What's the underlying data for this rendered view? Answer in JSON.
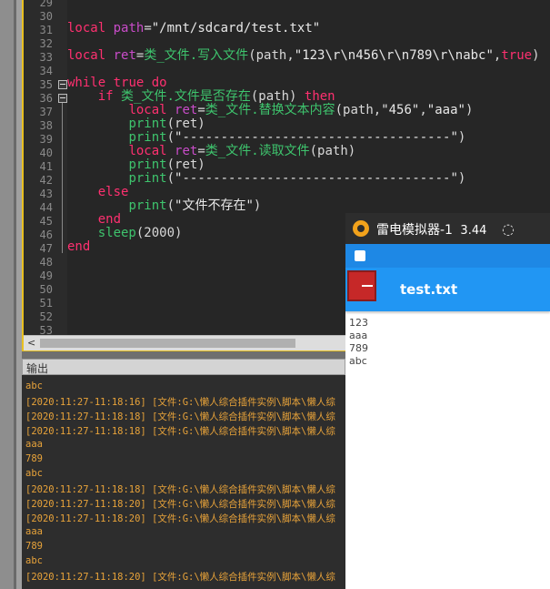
{
  "editor": {
    "line_numbers": [
      "29",
      "30",
      "31",
      "32",
      "33",
      "34",
      "35",
      "36",
      "37",
      "38",
      "39",
      "40",
      "41",
      "42",
      "43",
      "44",
      "45",
      "46",
      "47",
      "48",
      "49",
      "50",
      "51",
      "52",
      "53"
    ],
    "lines": [
      {
        "n": "31",
        "tokens": [
          [
            "kw",
            "local"
          ],
          [
            "plain",
            " "
          ],
          [
            "var",
            "path"
          ],
          [
            "plain",
            "="
          ],
          [
            "str",
            "\"/mnt/sdcard/test.txt\""
          ]
        ]
      },
      {
        "n": "33",
        "tokens": [
          [
            "kw",
            "local"
          ],
          [
            "plain",
            " "
          ],
          [
            "var",
            "ret"
          ],
          [
            "plain",
            "="
          ],
          [
            "fn",
            "类_文件.写入文件"
          ],
          [
            "plain",
            "(path,"
          ],
          [
            "str",
            "\"123\\r\\n456\\r\\n789\\r\\nabc\""
          ],
          [
            "plain",
            ","
          ],
          [
            "kw",
            "true"
          ],
          [
            "plain",
            ")"
          ]
        ]
      },
      {
        "n": "35",
        "tokens": [
          [
            "kw",
            "while"
          ],
          [
            "plain",
            " "
          ],
          [
            "kw",
            "true"
          ],
          [
            "plain",
            " "
          ],
          [
            "kw",
            "do"
          ]
        ]
      },
      {
        "n": "36",
        "tokens": [
          [
            "plain",
            "    "
          ],
          [
            "kw",
            "if"
          ],
          [
            "plain",
            " "
          ],
          [
            "fn",
            "类_文件.文件是否存在"
          ],
          [
            "plain",
            "(path) "
          ],
          [
            "kw",
            "then"
          ]
        ]
      },
      {
        "n": "37",
        "tokens": [
          [
            "plain",
            "        "
          ],
          [
            "kw",
            "local"
          ],
          [
            "plain",
            " "
          ],
          [
            "var",
            "ret"
          ],
          [
            "plain",
            "="
          ],
          [
            "fn",
            "类_文件.替换文本内容"
          ],
          [
            "plain",
            "(path,"
          ],
          [
            "str",
            "\"456\""
          ],
          [
            "plain",
            ","
          ],
          [
            "str",
            "\"aaa\""
          ],
          [
            "plain",
            ")"
          ]
        ]
      },
      {
        "n": "38",
        "tokens": [
          [
            "plain",
            "        "
          ],
          [
            "fn",
            "print"
          ],
          [
            "plain",
            "(ret)"
          ]
        ]
      },
      {
        "n": "39",
        "tokens": [
          [
            "plain",
            "        "
          ],
          [
            "fn",
            "print"
          ],
          [
            "plain",
            "("
          ],
          [
            "str",
            "\"-----------------------------------\""
          ],
          [
            "plain",
            ")"
          ]
        ]
      },
      {
        "n": "40",
        "tokens": [
          [
            "plain",
            "        "
          ],
          [
            "kw",
            "local"
          ],
          [
            "plain",
            " "
          ],
          [
            "var",
            "ret"
          ],
          [
            "plain",
            "="
          ],
          [
            "fn",
            "类_文件.读取文件"
          ],
          [
            "plain",
            "(path)"
          ]
        ]
      },
      {
        "n": "41",
        "tokens": [
          [
            "plain",
            "        "
          ],
          [
            "fn",
            "print"
          ],
          [
            "plain",
            "(ret)"
          ]
        ]
      },
      {
        "n": "42",
        "tokens": [
          [
            "plain",
            "        "
          ],
          [
            "fn",
            "print"
          ],
          [
            "plain",
            "("
          ],
          [
            "str",
            "\"-----------------------------------\""
          ],
          [
            "plain",
            ")"
          ]
        ]
      },
      {
        "n": "43",
        "tokens": [
          [
            "plain",
            "    "
          ],
          [
            "kw",
            "else"
          ]
        ]
      },
      {
        "n": "44",
        "tokens": [
          [
            "plain",
            "        "
          ],
          [
            "fn",
            "print"
          ],
          [
            "plain",
            "("
          ],
          [
            "str",
            "\"文件不存在\""
          ],
          [
            "plain",
            ")"
          ]
        ]
      },
      {
        "n": "45",
        "tokens": [
          [
            "plain",
            "    "
          ],
          [
            "kw",
            "end"
          ]
        ]
      },
      {
        "n": "46",
        "tokens": [
          [
            "plain",
            "    "
          ],
          [
            "fn",
            "sleep"
          ],
          [
            "plain",
            "(2000)"
          ]
        ]
      },
      {
        "n": "47",
        "tokens": [
          [
            "kw",
            "end"
          ]
        ]
      }
    ]
  },
  "output": {
    "title": "输出",
    "lines": [
      "abc",
      "[2020:11:27-11:18:16] [文件:G:\\懒人综合插件实例\\脚本\\懒人综",
      "[2020:11:27-11:18:18] [文件:G:\\懒人综合插件实例\\脚本\\懒人综",
      "[2020:11:27-11:18:18] [文件:G:\\懒人综合插件实例\\脚本\\懒人综",
      "aaa",
      "789",
      "abc",
      "[2020:11:27-11:18:18] [文件:G:\\懒人综合插件实例\\脚本\\懒人综",
      "[2020:11:27-11:18:20] [文件:G:\\懒人综合插件实例\\脚本\\懒人综",
      "[2020:11:27-11:18:20] [文件:G:\\懒人综合插件实例\\脚本\\懒人综",
      "aaa",
      "789",
      "abc",
      "[2020:11:27-11:18:20] [文件:G:\\懒人综合插件实例\\脚本\\懒人综"
    ]
  },
  "emulator": {
    "title": "雷电模拟器-1",
    "version": "3.44",
    "app_title": "test.txt",
    "content_lines": [
      "123",
      "aaa",
      "789",
      "abc"
    ]
  },
  "colors": {
    "keyword": "#ff3070",
    "function": "#3ec46d",
    "variable": "#c94cc9",
    "accent": "#2196f3"
  }
}
